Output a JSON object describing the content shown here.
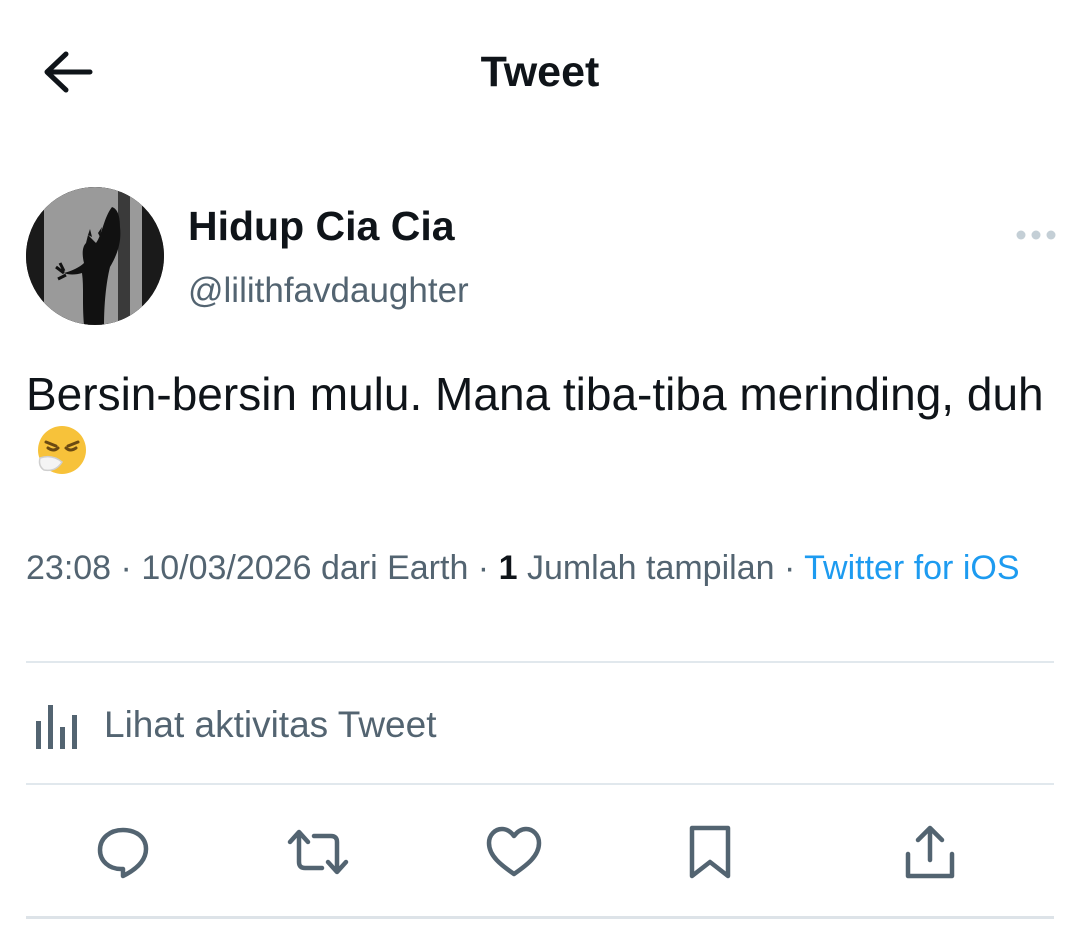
{
  "header": {
    "title": "Tweet",
    "back_icon": "arrow-left-icon"
  },
  "tweet": {
    "author": {
      "display_name": "Hidup Cia Cia",
      "handle": "@lilithfavdaughter",
      "avatar": "silhouette-avatar"
    },
    "more_icon": "more-horizontal-icon",
    "text": "Bersin-bersin mulu. Mana tiba-tiba merinding, duh",
    "emoji": "sneezing-face-emoji",
    "meta": {
      "time": "23:08",
      "date": "10/03/2026",
      "location_prefix": "dari",
      "location": "Earth",
      "separator": " · ",
      "views_count": "1",
      "views_label": "Jumlah tampilan",
      "source": "Twitter for iOS"
    },
    "activity_label": "Lihat aktivitas Tweet",
    "activity_icon": "bar-chart-icon",
    "actions": [
      "reply-icon",
      "retweet-icon",
      "like-icon",
      "bookmark-icon",
      "share-icon"
    ]
  },
  "colors": {
    "text_primary": "#0f1419",
    "text_secondary": "#536471",
    "link": "#1d9bf0",
    "divider": "#e1e8ed"
  }
}
